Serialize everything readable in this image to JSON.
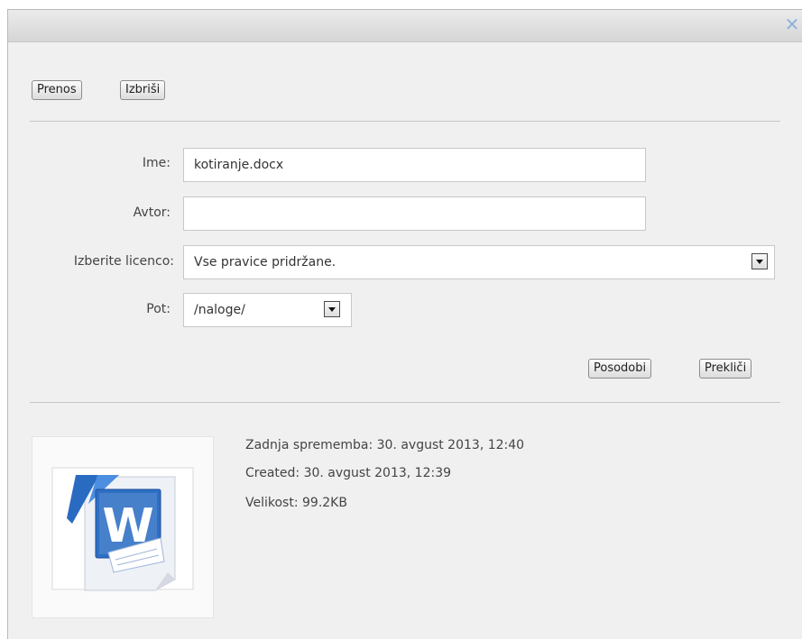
{
  "toolbar": {
    "upload_label": "Prenos",
    "delete_label": "Izbriši"
  },
  "form": {
    "name_label": "Ime:",
    "name_value": "kotiranje.docx",
    "author_label": "Avtor:",
    "author_value": "",
    "license_label": "Izberite licenco:",
    "license_value": "Vse pravice pridržane.",
    "path_label": "Pot:",
    "path_value": "/naloge/"
  },
  "actions": {
    "update_label": "Posodobi",
    "cancel_label": "Prekliči"
  },
  "file_info": {
    "modified": "Zadnja sprememba: 30. avgust 2013, 12:40",
    "created": "Created: 30. avgust 2013, 12:39",
    "size": "Velikost: 99.2KB"
  },
  "icons": {
    "close": "close-icon",
    "file": "word-document-icon"
  },
  "colors": {
    "dialog_bg": "#f0f0f0",
    "accent_blue": "#1f5fb5"
  }
}
